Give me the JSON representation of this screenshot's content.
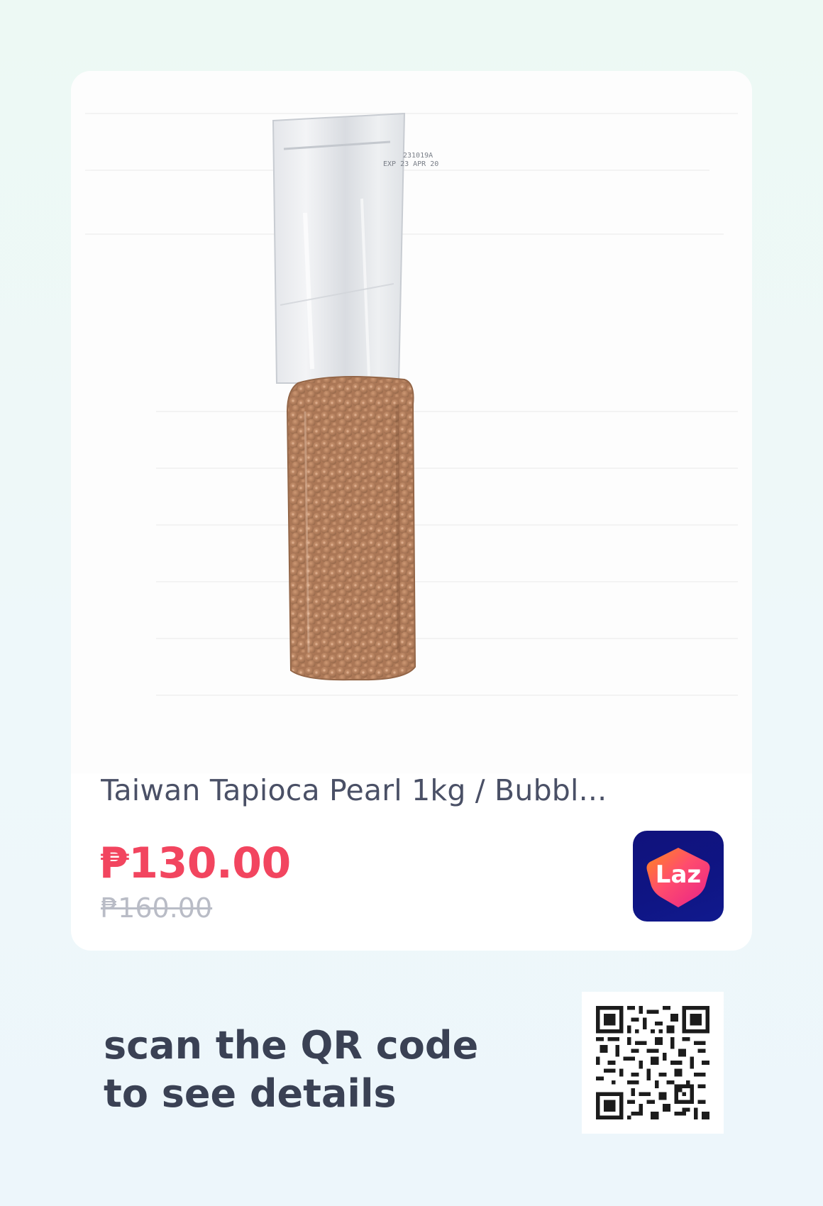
{
  "product": {
    "title": "Taiwan Tapioca Pearl 1kg / Bubbl...",
    "price": "₱130.00",
    "original_price": "₱160.00",
    "image_icon": "tapioca-pearl-bag-image"
  },
  "store": {
    "logo_text": "Laz",
    "icon": "lazada-logo-icon"
  },
  "cta": {
    "line1": "scan the QR code",
    "line2": "to see details"
  },
  "colors": {
    "price": "#f2455f",
    "title": "#4a5066",
    "original_price": "#b9bcc6",
    "cta": "#3a4154",
    "logo_bg": "#10127c"
  }
}
